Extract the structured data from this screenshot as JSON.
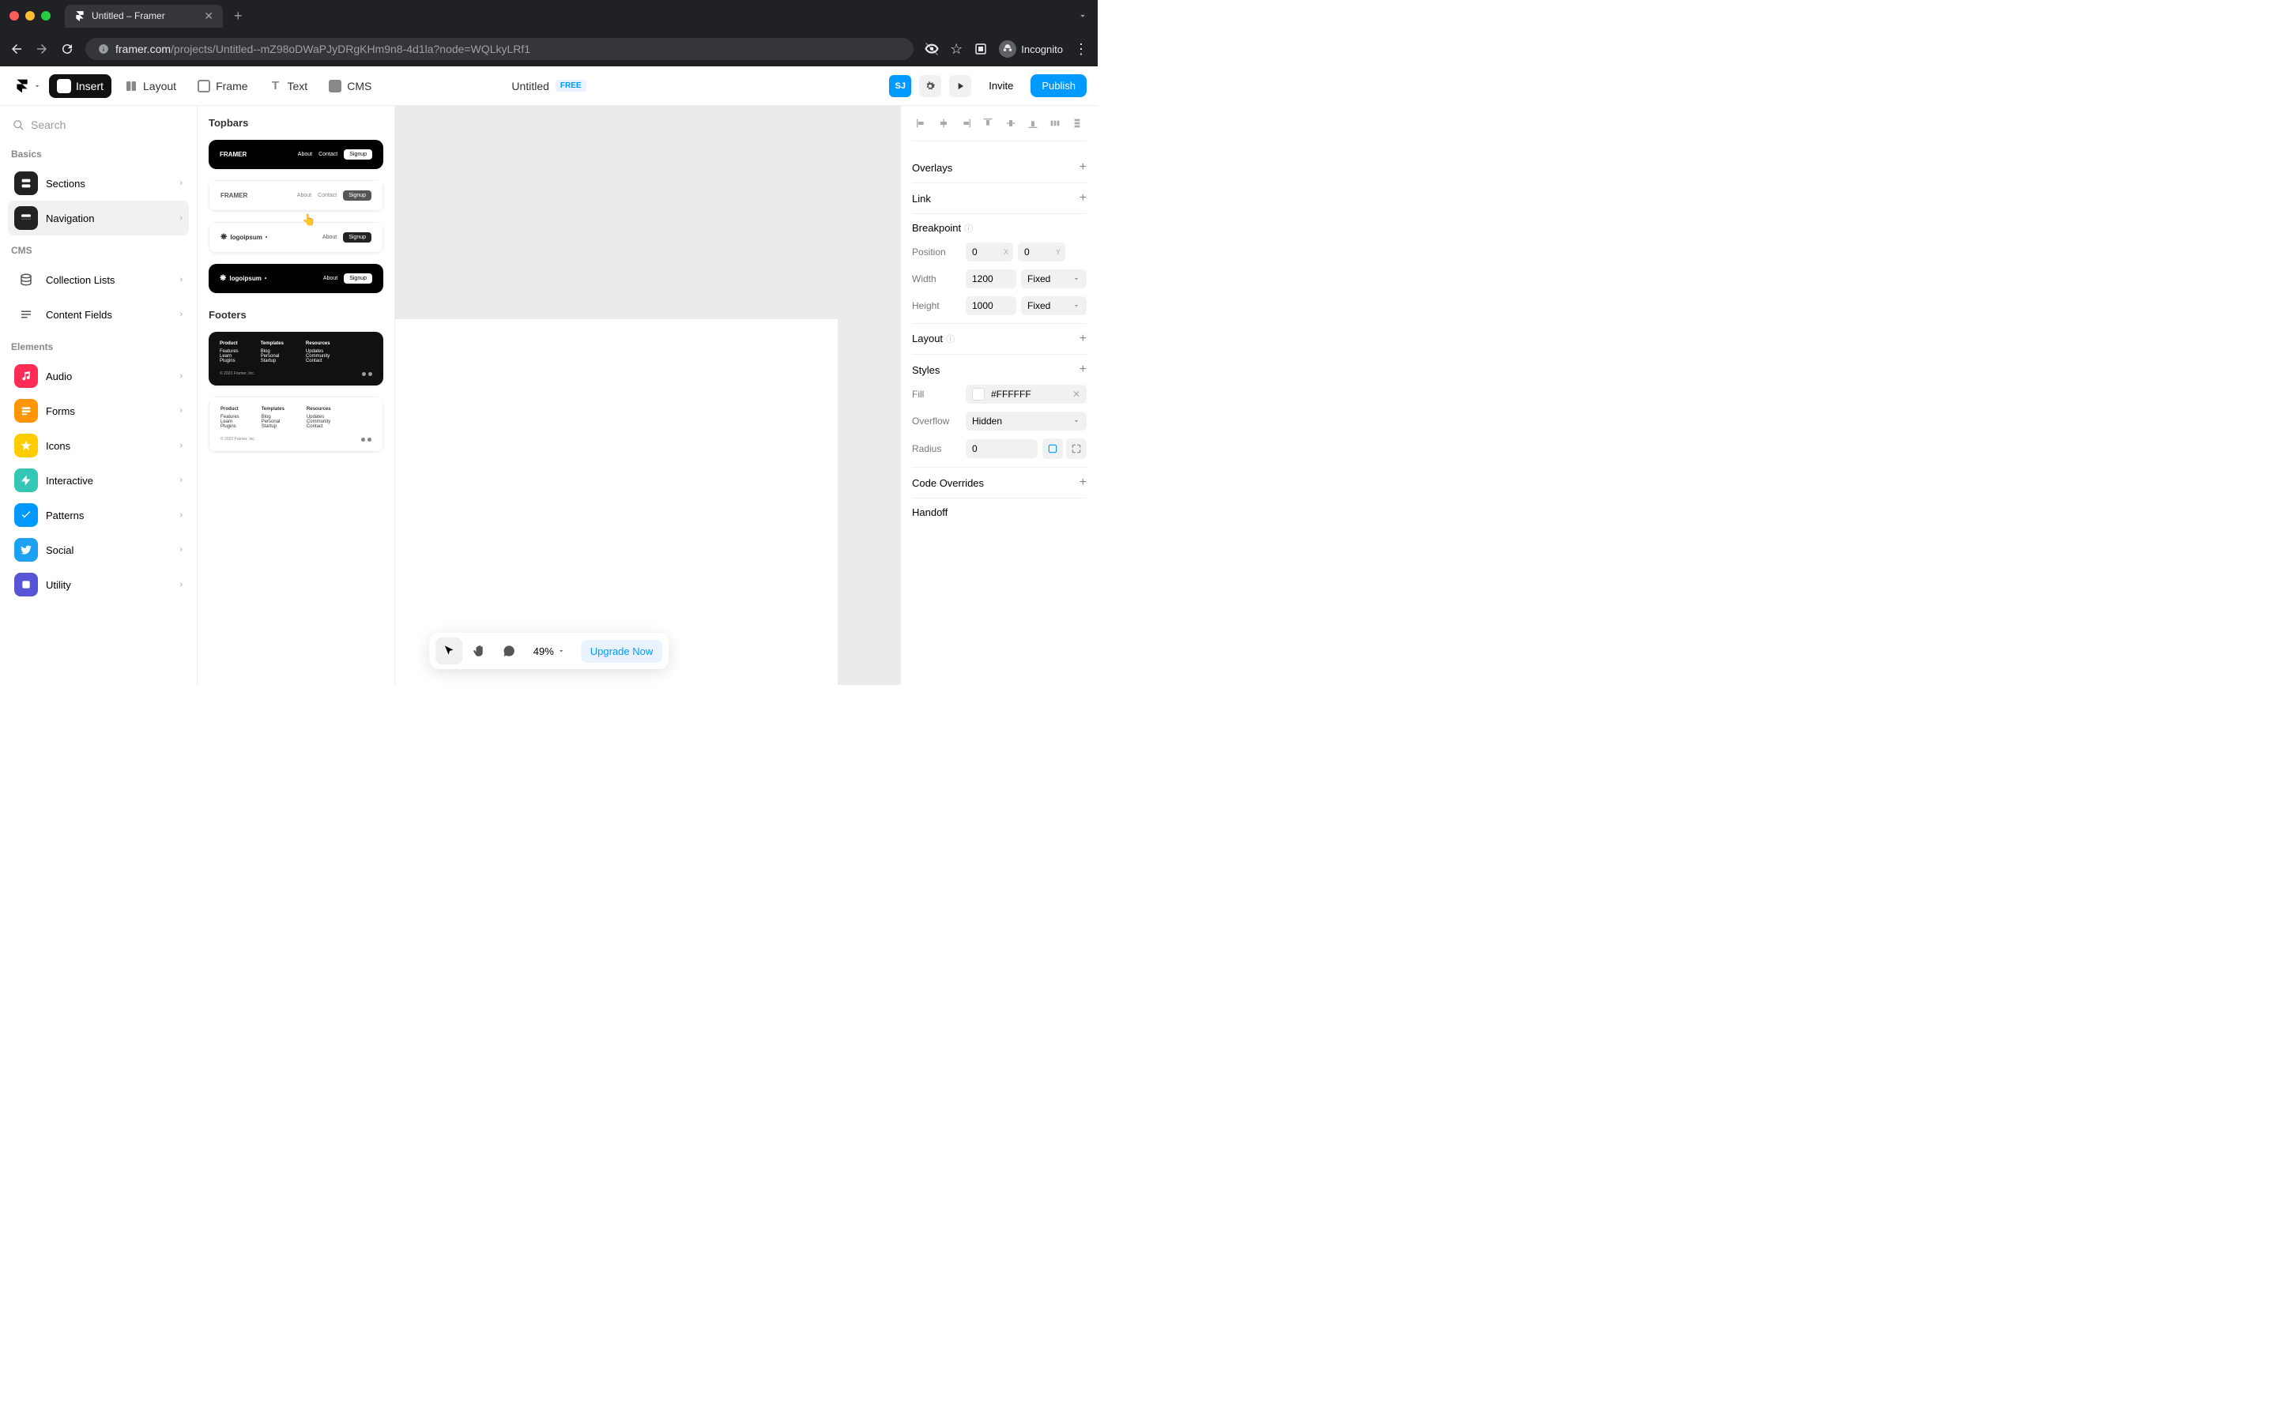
{
  "browser": {
    "tab_title": "Untitled – Framer",
    "url_display_domain": "framer.com",
    "url_display_path": "/projects/Untitled--mZ98oDWaPJyDRgKHm9n8-4d1la?node=WQLkyLRf1",
    "incognito_label": "Incognito"
  },
  "toolbar": {
    "insert": "Insert",
    "layout": "Layout",
    "frame": "Frame",
    "text": "Text",
    "cms": "CMS",
    "doc_title": "Untitled",
    "plan_badge": "FREE",
    "avatar_initials": "SJ",
    "invite": "Invite",
    "publish": "Publish"
  },
  "sidebar": {
    "search_placeholder": "Search",
    "basics_label": "Basics",
    "basics": [
      {
        "label": "Sections"
      },
      {
        "label": "Navigation"
      }
    ],
    "cms_label": "CMS",
    "cms": [
      {
        "label": "Collection Lists"
      },
      {
        "label": "Content Fields"
      }
    ],
    "elements_label": "Elements",
    "elements": [
      {
        "label": "Audio",
        "color": "pink"
      },
      {
        "label": "Forms",
        "color": "orange"
      },
      {
        "label": "Icons",
        "color": "yellow"
      },
      {
        "label": "Interactive",
        "color": "teal"
      },
      {
        "label": "Patterns",
        "color": "blue"
      },
      {
        "label": "Social",
        "color": "sky"
      },
      {
        "label": "Utility",
        "color": "purple"
      }
    ]
  },
  "insert_panel": {
    "topbars_heading": "Topbars",
    "footers_heading": "Footers",
    "topbar_brand": "FRAMER",
    "topbar_logobrand": "logoipsum",
    "topbar_links": {
      "about": "About",
      "contact": "Contact",
      "signup": "Signup"
    },
    "footer": {
      "col1_title": "Product",
      "col1_items": [
        "Features",
        "Learn",
        "Plugins"
      ],
      "col2_title": "Templates",
      "col2_items": [
        "Blog",
        "Personal",
        "Startup"
      ],
      "col3_title": "Resources",
      "col3_items": [
        "Updates",
        "Community",
        "Contact"
      ],
      "copyright": "© 2023 Framer, Inc."
    }
  },
  "inspector": {
    "overlays": "Overlays",
    "link": "Link",
    "breakpoint": "Breakpoint",
    "position_label": "Position",
    "position_x": "0",
    "position_y": "0",
    "width_label": "Width",
    "width_value": "1200",
    "width_mode": "Fixed",
    "height_label": "Height",
    "height_value": "1000",
    "height_mode": "Fixed",
    "layout": "Layout",
    "styles": "Styles",
    "fill_label": "Fill",
    "fill_value": "#FFFFFF",
    "overflow_label": "Overflow",
    "overflow_value": "Hidden",
    "radius_label": "Radius",
    "radius_value": "0",
    "code_overrides": "Code Overrides",
    "handoff": "Handoff"
  },
  "floatbar": {
    "zoom": "49%",
    "upgrade": "Upgrade Now"
  }
}
